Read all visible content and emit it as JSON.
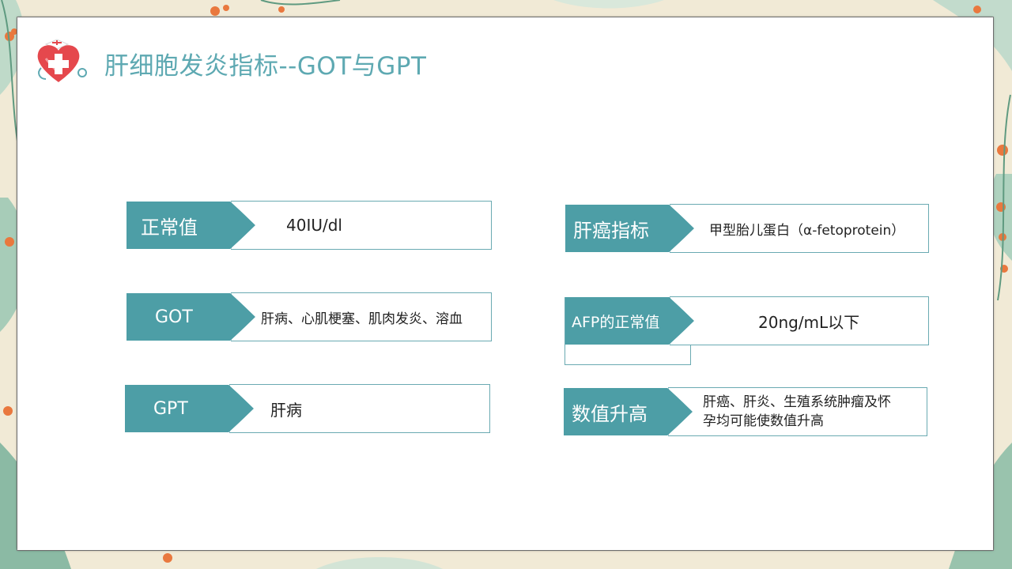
{
  "slide": {
    "title": "肝细胞发炎指标--GOT与GPT"
  },
  "left_items": [
    {
      "label": "正常值",
      "value": "40IU/dl"
    },
    {
      "label": "GOT",
      "value": "肝病、心肌梗塞、肌肉发炎、溶血"
    },
    {
      "label": "GPT",
      "value": "肝病"
    }
  ],
  "right_items": [
    {
      "label": "肝癌指标",
      "value": "甲型胎儿蛋白（α-fetoprotein）"
    },
    {
      "label": "AFP的正常值",
      "value": "20ng/mL以下"
    },
    {
      "label": "数值升高",
      "value_line1": "肝癌、肝炎、生殖系统肿瘤及怀",
      "value_line2": "孕均可能使数值升高"
    }
  ],
  "colors": {
    "accent": "#4d9ea6",
    "title": "#5ea9b2",
    "border": "#6aaab2",
    "logo_heart": "#e5484d"
  },
  "icons": {
    "logo": "medical-heart-cross-icon"
  }
}
